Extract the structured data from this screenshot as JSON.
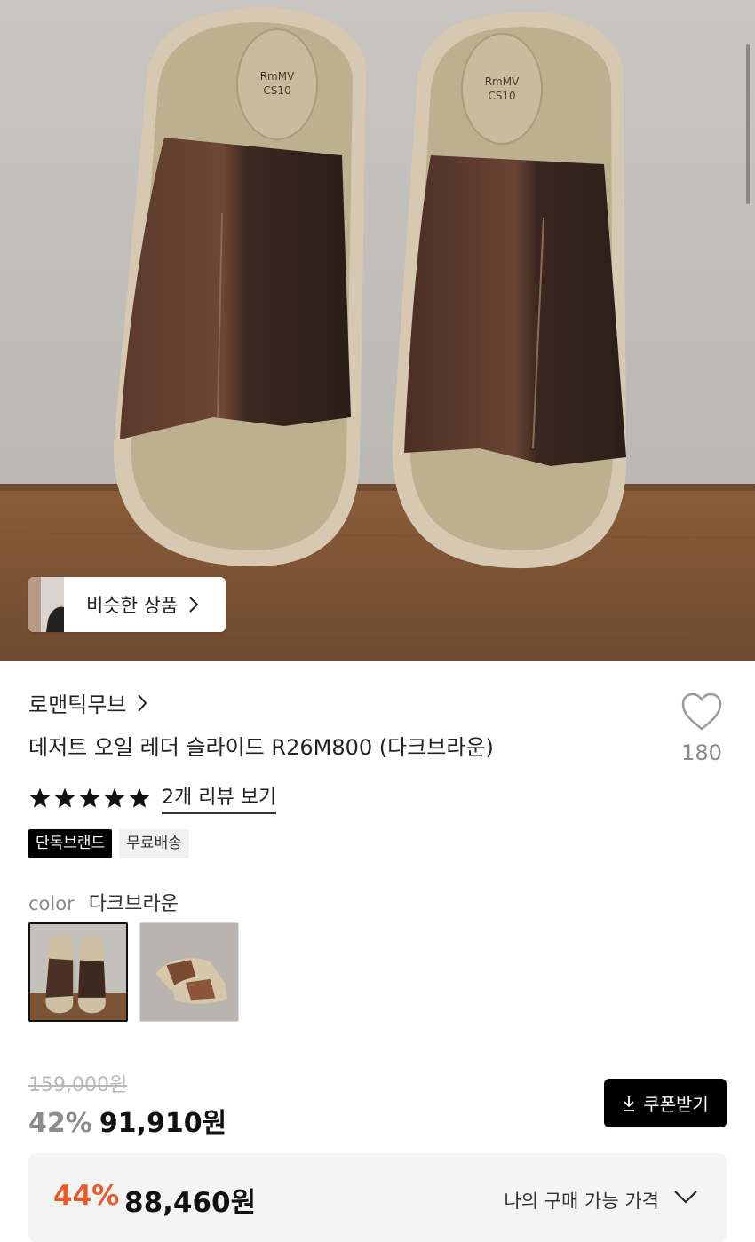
{
  "hero": {
    "similar_label": "비슷한 상품",
    "logo_text": "RmMV CS10"
  },
  "product": {
    "brand": "로맨틱무브",
    "title": "데저트 오일 레더 슬라이드 R26M800 (다크브라운)",
    "like_count": "180",
    "rating_stars": 5,
    "review_link": "2개 리뷰 보기",
    "badges": [
      "단독브랜드",
      "무료배송"
    ],
    "color_label": "color",
    "color_value": "다크브라운"
  },
  "pricing": {
    "original_price": "159,000원",
    "discount_rate": "42%",
    "sale_price": "91,910원",
    "coupon_button": "쿠폰받기",
    "best_discount_rate": "44%",
    "best_price": "88,460원",
    "best_price_label": "나의 구매 가능 가격"
  },
  "colors": {
    "accent_orange": "#e8592b",
    "button_black": "#000000"
  },
  "icons": [
    "chevron-right-icon",
    "heart-icon",
    "star-icon",
    "download-icon",
    "chevron-down-icon"
  ]
}
